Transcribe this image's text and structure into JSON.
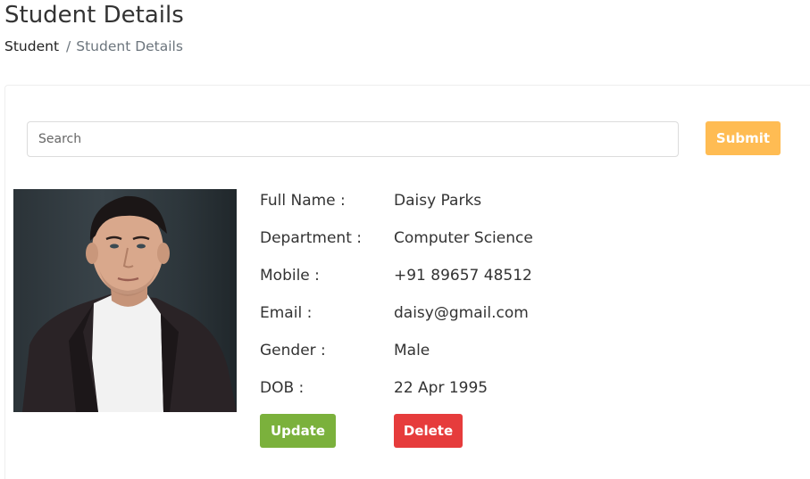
{
  "header": {
    "title": "Student Details",
    "breadcrumb": {
      "parent": "Student",
      "separator": "/",
      "current": "Student Details"
    }
  },
  "search": {
    "placeholder": "Search",
    "value": "",
    "submit_label": "Submit"
  },
  "profile": {
    "photo_icon": "student-photo",
    "fields": [
      {
        "label": "Full Name :",
        "value": "Daisy Parks"
      },
      {
        "label": "Department :",
        "value": "Computer Science"
      },
      {
        "label": "Mobile :",
        "value": "+91 89657 48512"
      },
      {
        "label": "Email :",
        "value": "daisy@gmail.com"
      },
      {
        "label": "Gender :",
        "value": "Male"
      },
      {
        "label": "DOB :",
        "value": "22 Apr 1995"
      }
    ]
  },
  "actions": {
    "update_label": "Update",
    "delete_label": "Delete"
  },
  "colors": {
    "submit": "#ffbc53",
    "update": "#7bb13c",
    "delete": "#e63c3c",
    "muted_text": "#6c757d"
  }
}
